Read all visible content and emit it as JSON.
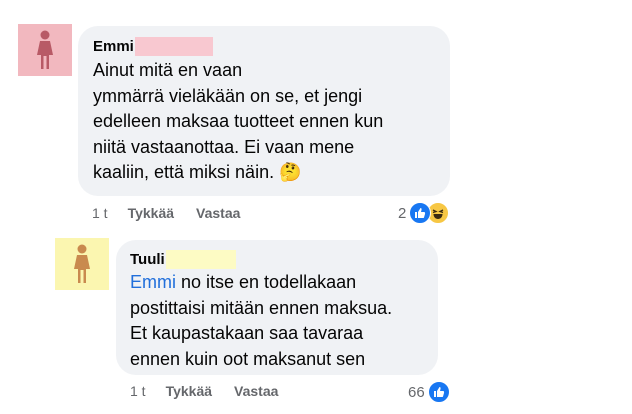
{
  "comments": [
    {
      "author": "Emmi",
      "text": "Ainut mitä en vaan\nymmärrä vieläkään on se, et jengi\nedelleen maksaa tuotteet ennen kun\nniitä vastaanottaa. Ei vaan mene\nkaaliin, että miksi näin. 🤔",
      "time": "1 t",
      "like_label": "Tykkää",
      "reply_label": "Vastaa",
      "reaction_count": "2",
      "reaction_icons": [
        "like-icon",
        "laugh-icon"
      ],
      "avatar_icon": "female-person-icon",
      "avatar_bg": "#f2b8bf",
      "avatar_fg": "#b85a66",
      "redaction_color": "#f8c8d0"
    },
    {
      "author": "Tuuli",
      "mention": "Emmi",
      "text": " no itse en todellakaan\npostittaisi mitään ennen maksua.\nEt kaupastakaan saa tavaraa\nennen kuin oot maksanut sen",
      "time": "1 t",
      "like_label": "Tykkää",
      "reply_label": "Vastaa",
      "reaction_count": "66",
      "reaction_icons": [
        "like-icon"
      ],
      "avatar_icon": "female-person-icon",
      "avatar_bg": "#fbf6b0",
      "avatar_fg": "#c98a4e",
      "redaction_color": "#fdfbc4"
    }
  ],
  "colors": {
    "bubble": "#f0f2f5",
    "mention": "#216fdb",
    "meta": "#65676b",
    "like_blue": "#1877f2",
    "laugh_yellow": "#f7c744"
  }
}
